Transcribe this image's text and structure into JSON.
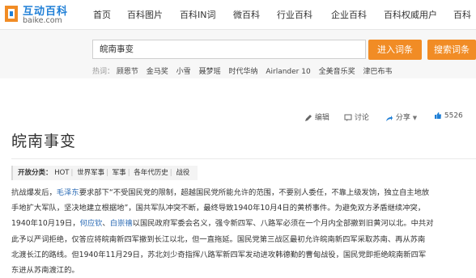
{
  "brand": {
    "name": "互动百科",
    "url": "baike.com",
    "accent": "#1f7fd6",
    "orange": "#f18c25"
  },
  "nav": [
    "首页",
    "百科图片",
    "百科IN词",
    "微百科",
    "行业百科",
    "企业百科",
    "百科权威用户",
    "百科"
  ],
  "search": {
    "value": "皖南事变",
    "enter_button": "进入词条",
    "search_button": "搜索词条"
  },
  "hot": {
    "label": "热词：",
    "words": [
      "顾恩节",
      "金马奖",
      "小雪",
      "聂梦瑶",
      "时代华纳",
      "Airlander 10",
      "全美音乐奖",
      "津巴布韦"
    ]
  },
  "toolbar": {
    "edit": "编辑",
    "discuss": "讨论",
    "share": "分享",
    "likes": "5526"
  },
  "article": {
    "title": "皖南事变",
    "tags_label": "开放分类：",
    "tags": [
      "HOT",
      "世界军事",
      "军事",
      "各年代历史",
      "战役"
    ],
    "paragraph": [
      [
        "抗战爆发后，",
        "毛泽东",
        "要求部下“不受国民党的限制，超越国民党所能允许的范围，不要别人委任，不靠上级发饷，独立自主地放"
      ],
      [
        "手地扩大军队，坚决地建立根据地”，国共军队冲突不断，最终导致1940年10月4日的黄桥事件。为避免双方矛盾继续冲突，"
      ],
      [
        "1940年10月19日，",
        "何应钦",
        "、",
        "白崇禧",
        "以国民政府军委会名义，强令新四军、八路军必须在一个月内全部撤到旧黄河以北。中共对"
      ],
      [
        "此予以严词拒绝，仅答应将皖南新四军撤到长江以北，但一直拖延。国民党第三战区最初允许皖南新四军采取苏南、再从苏南"
      ],
      [
        "北渡长江的路线。但1940年11月29日，苏北刘少奇指挥八路军新四军发动进攻韩德勤的曹甸战役，国民党即拒绝皖南新四军"
      ],
      [
        "东进从苏南渡江的。"
      ]
    ]
  }
}
